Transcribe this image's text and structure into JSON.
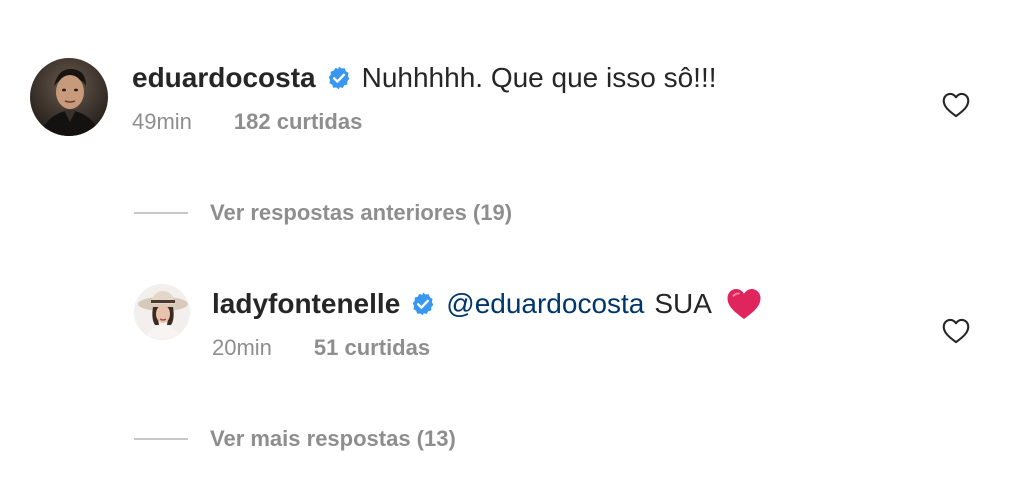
{
  "comment": {
    "username": "eduardocosta",
    "text": "Nuhhhhh. Que que isso sô!!!",
    "time": "49min",
    "likes": "182 curtidas"
  },
  "view_previous_replies": "Ver respostas anteriores (19)",
  "reply": {
    "username": "ladyfontenelle",
    "mention": "@eduardocosta",
    "text": "SUA",
    "time": "20min",
    "likes": "51 curtidas"
  },
  "view_more_replies": "Ver mais respostas (13)",
  "icons": {
    "verified": "verified-badge-icon",
    "like": "heart-outline-icon",
    "emoji": "red-heart-emoji"
  },
  "colors": {
    "verified_blue": "#3897f0",
    "mention_blue": "#00376b",
    "meta_gray": "#8e8e8e",
    "emoji_red": "#e0245e"
  }
}
